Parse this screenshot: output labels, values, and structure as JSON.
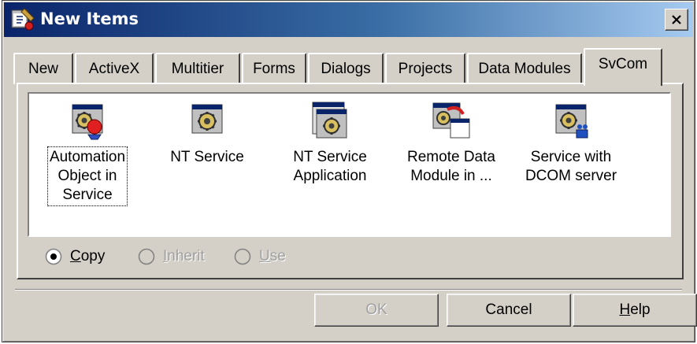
{
  "window": {
    "title": "New Items",
    "close_glyph": "✕",
    "icon": "delphi-app-icon"
  },
  "tabs": [
    {
      "label": "New"
    },
    {
      "label": "ActiveX"
    },
    {
      "label": "Multitier"
    },
    {
      "label": "Forms"
    },
    {
      "label": "Dialogs"
    },
    {
      "label": "Projects"
    },
    {
      "label": "Data Modules"
    },
    {
      "label": "SvCom",
      "active": true
    }
  ],
  "items": [
    {
      "label": "Automation\nObject in\nService",
      "icon": "automation-object-icon",
      "focused": true
    },
    {
      "label": "NT Service",
      "icon": "nt-service-icon"
    },
    {
      "label": "NT Service\nApplication",
      "icon": "nt-service-application-icon"
    },
    {
      "label": "Remote Data\nModule in ...",
      "icon": "remote-data-module-icon"
    },
    {
      "label": "Service with\nDCOM server",
      "icon": "dcom-server-icon"
    }
  ],
  "options": {
    "copy": {
      "label": "Copy",
      "mnemonic": "C",
      "rest": "opy",
      "checked": true,
      "enabled": true
    },
    "inherit": {
      "label": "Inherit",
      "mnemonic": "I",
      "rest": "nherit",
      "checked": false,
      "enabled": false
    },
    "use": {
      "label": "Use",
      "mnemonic": "U",
      "rest": "se",
      "checked": false,
      "enabled": false
    }
  },
  "buttons": {
    "ok": {
      "label": "OK",
      "enabled": false
    },
    "cancel": {
      "label": "Cancel",
      "enabled": true
    },
    "help": {
      "label": "Help",
      "mnemonic": "H",
      "rest": "elp",
      "enabled": true
    }
  },
  "colors": {
    "titlebar_start": "#0a246a",
    "titlebar_end": "#a6caf0",
    "face": "#d4d0c8"
  }
}
